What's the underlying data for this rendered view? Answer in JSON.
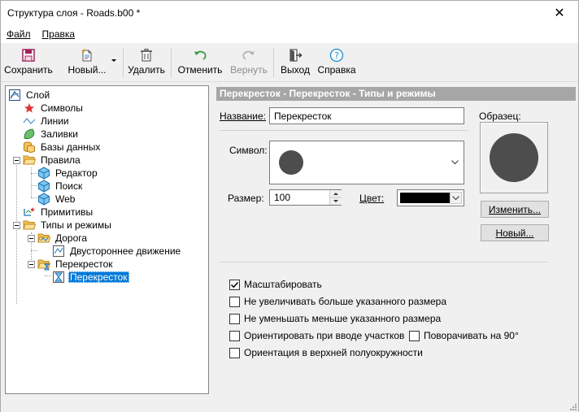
{
  "window": {
    "title": "Структура слоя - Roads.b00 *",
    "close_glyph": "✕"
  },
  "menu": {
    "file": "Файл",
    "edit": "Правка"
  },
  "toolbar": {
    "save": "Сохранить",
    "new": "Новый...",
    "delete": "Удалить",
    "undo": "Отменить",
    "redo": "Вернуть",
    "exit": "Выход",
    "help": "Справка"
  },
  "tree": {
    "layer": "Слой",
    "symbols": "Символы",
    "lines": "Линии",
    "fills": "Заливки",
    "databases": "Базы данных",
    "rules": "Правила",
    "editor": "Редактор",
    "search": "Поиск",
    "web": "Web",
    "primitives": "Примитивы",
    "types_modes": "Типы и режимы",
    "road": "Дорога",
    "two_way": "Двустороннее движение",
    "crossroad": "Перекресток",
    "crossroad_child": "Перекресток"
  },
  "panel": {
    "header": "Перекресток - Перекресток - Типы и режимы",
    "name_label": "Название:",
    "name_value": "Перекресток",
    "sample_label": "Образец:",
    "symbol_label": "Символ:",
    "size_label": "Размер:",
    "size_value": "100",
    "color_label": "Цвет:",
    "color_value": "#000000",
    "change_button": "Изменить...",
    "new_button": "Новый...",
    "symbol_color": "#4d4d4d"
  },
  "options": {
    "scale": {
      "label": "Масштабировать",
      "checked": true
    },
    "no_increase": {
      "label": "Не увеличивать больше указанного размера",
      "checked": false
    },
    "no_decrease": {
      "label": "Не уменьшать меньше указанного размера",
      "checked": false
    },
    "orient_input": {
      "label": "Ориентировать при вводе участков",
      "checked": false
    },
    "rotate_90": {
      "label": "Поворачивать на 90°",
      "checked": false
    },
    "orient_upper": {
      "label": "Ориентация в верхней полуокружности",
      "checked": false
    }
  }
}
